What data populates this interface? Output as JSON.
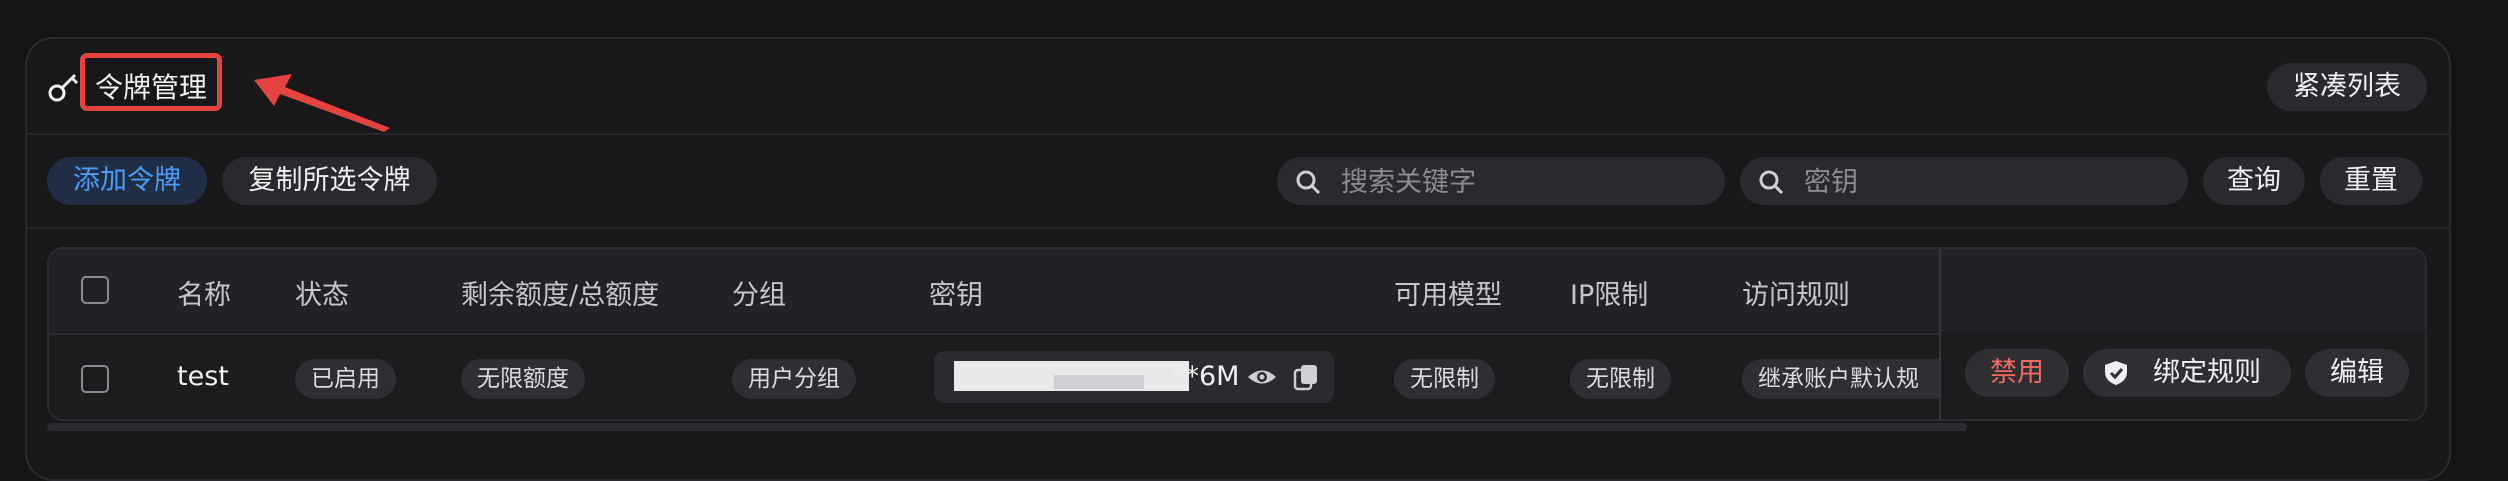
{
  "header": {
    "title": "令牌管理",
    "compact_button": "紧凑列表"
  },
  "toolbar": {
    "add_token": "添加令牌",
    "copy_selected": "复制所选令牌",
    "search_keyword_placeholder": "搜索关键字",
    "search_key_placeholder": "密钥",
    "query_button": "查询",
    "reset_button": "重置"
  },
  "table": {
    "columns": [
      "名称",
      "状态",
      "剩余额度/总额度",
      "分组",
      "密钥",
      "可用模型",
      "IP限制",
      "访问规则"
    ],
    "rows": [
      {
        "name": "test",
        "status": "已启用",
        "quota": "无限额度",
        "group": "用户分组",
        "key_visible_suffix": "**6M",
        "models": "无限制",
        "ip_limit": "无限制",
        "access_rule": "继承账户默认规",
        "actions": {
          "disable": "禁用",
          "bind_rules": "绑定规则",
          "edit": "编辑"
        }
      }
    ]
  },
  "colors": {
    "accent": "#4c9bf5",
    "danger": "#f06b5f",
    "annotation": "#e5433f"
  }
}
